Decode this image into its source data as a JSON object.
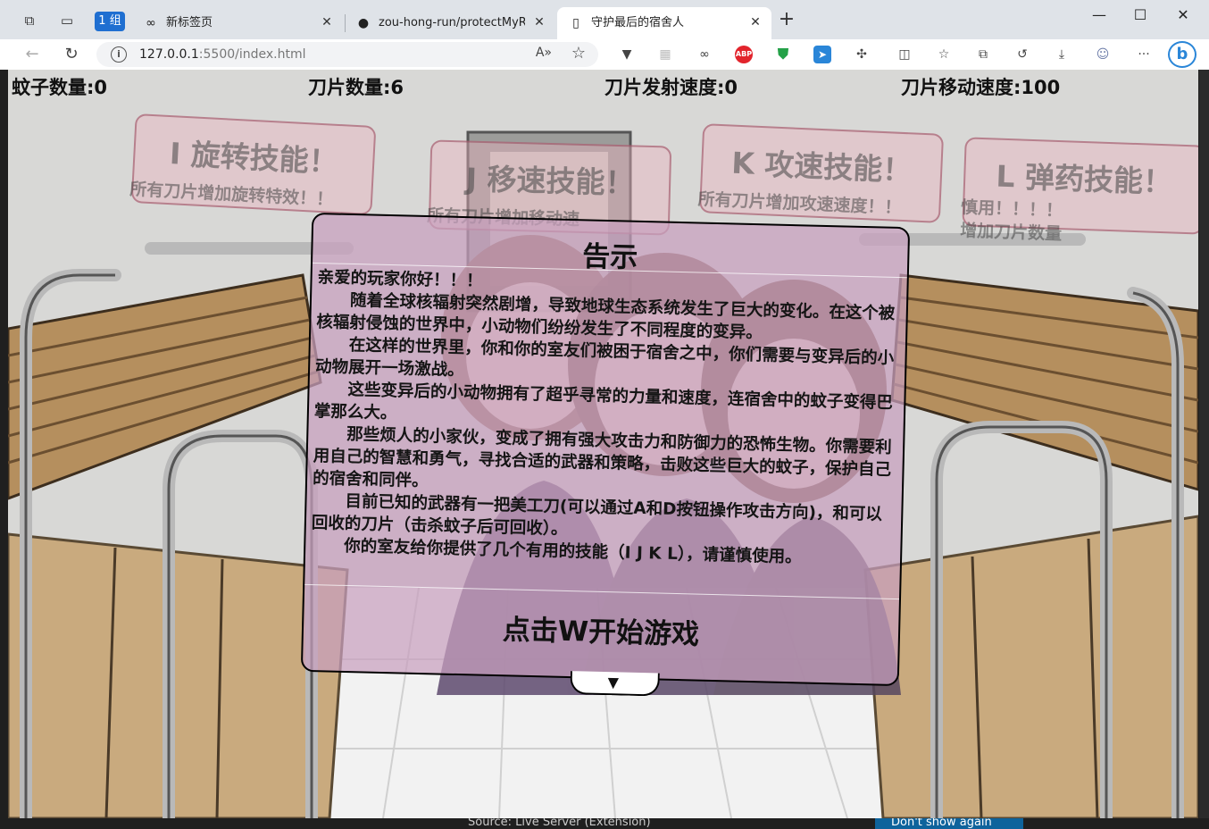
{
  "browser": {
    "group_badge": "1 组",
    "tabs": [
      {
        "title": "新标签页",
        "icon": "infinity-icon"
      },
      {
        "title": "zou-hong-run/protectMyRoom",
        "icon": "github-icon"
      },
      {
        "title": "守护最后的宿舍人",
        "icon": "page-icon",
        "active": true
      }
    ],
    "url_host": "127.0.0.1",
    "url_rest": ":5500/index.html",
    "accent": "#1f6fd1"
  },
  "hud": {
    "mosquito_count": "蚊子数量:0",
    "blade_count": "刀片数量:6",
    "fire_rate": "刀片发射速度:0",
    "move_speed": "刀片移动速度:100"
  },
  "skills": [
    {
      "title": "I 旋转技能！",
      "desc": "所有刀片增加旋转特效！！"
    },
    {
      "title": "J 移速技能！",
      "desc": "所有刀片增加移动速"
    },
    {
      "title": "K 攻速技能！",
      "desc": "所有刀片增加攻速速度！！"
    },
    {
      "title": "L 弹药技能！",
      "desc": "慎用！！！！",
      "desc2": "增加刀片数量"
    }
  ],
  "notice": {
    "title": "告示",
    "greeting": "亲爱的玩家你好！！！",
    "paragraphs": [
      "随着全球核辐射突然剧增，导致地球生态系统发生了巨大的变化。在这个被核辐射侵蚀的世界中，小动物们纷纷发生了不同程度的变异。",
      "在这样的世界里，你和你的室友们被困于宿舍之中，你们需要与变异后的小动物展开一场激战。",
      "这些变异后的小动物拥有了超乎寻常的力量和速度，连宿舍中的蚊子变得巴掌那么大。",
      "那些烦人的小家伙，变成了拥有强大攻击力和防御力的恐怖生物。你需要利用自己的智慧和勇气，寻找合适的武器和策略，击败这些巨大的蚊子，保护自己的宿舍和同伴。",
      "目前已知的武器有一把美工刀(可以通过A和D按钮操作攻击方向)，和可以回收的刀片（击杀蚊子后可回收）。",
      "你的室友给你提供了几个有用的技能（I J K L），请谨慎使用。"
    ],
    "start_hint": "点击W开始游戏"
  },
  "statusbar": {
    "source": "Source: Live Server (Extension)",
    "dont_show": "Don't show again"
  }
}
